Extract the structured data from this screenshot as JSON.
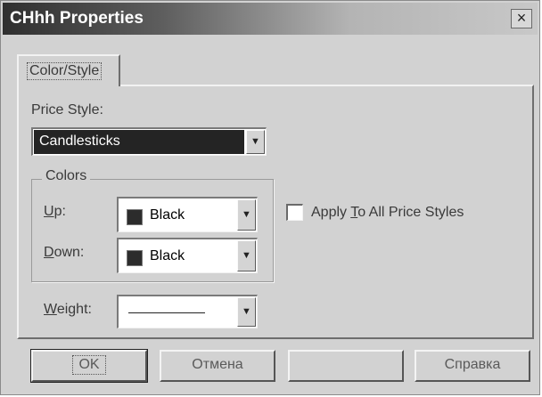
{
  "window": {
    "title": "CHhh Properties",
    "close_glyph": "×"
  },
  "tabs": [
    {
      "label": "Color/Style",
      "active": true
    }
  ],
  "price_style": {
    "label": "Price Style:",
    "value": "Candlesticks"
  },
  "colors_group": {
    "title": "Colors",
    "up": {
      "label": "Up:",
      "value": "Black",
      "swatch_color": "#2c2c2c"
    },
    "down": {
      "label": "Down:",
      "value": "Black",
      "swatch_color": "#2c2c2c"
    }
  },
  "apply_all": {
    "label": "Apply To All Price Styles",
    "checked": false
  },
  "weight": {
    "label": "Weight:"
  },
  "buttons": {
    "ok": "OK",
    "cancel": "Отмена",
    "apply": "",
    "help": "Справка"
  },
  "icons": {
    "dropdown": "▼"
  }
}
